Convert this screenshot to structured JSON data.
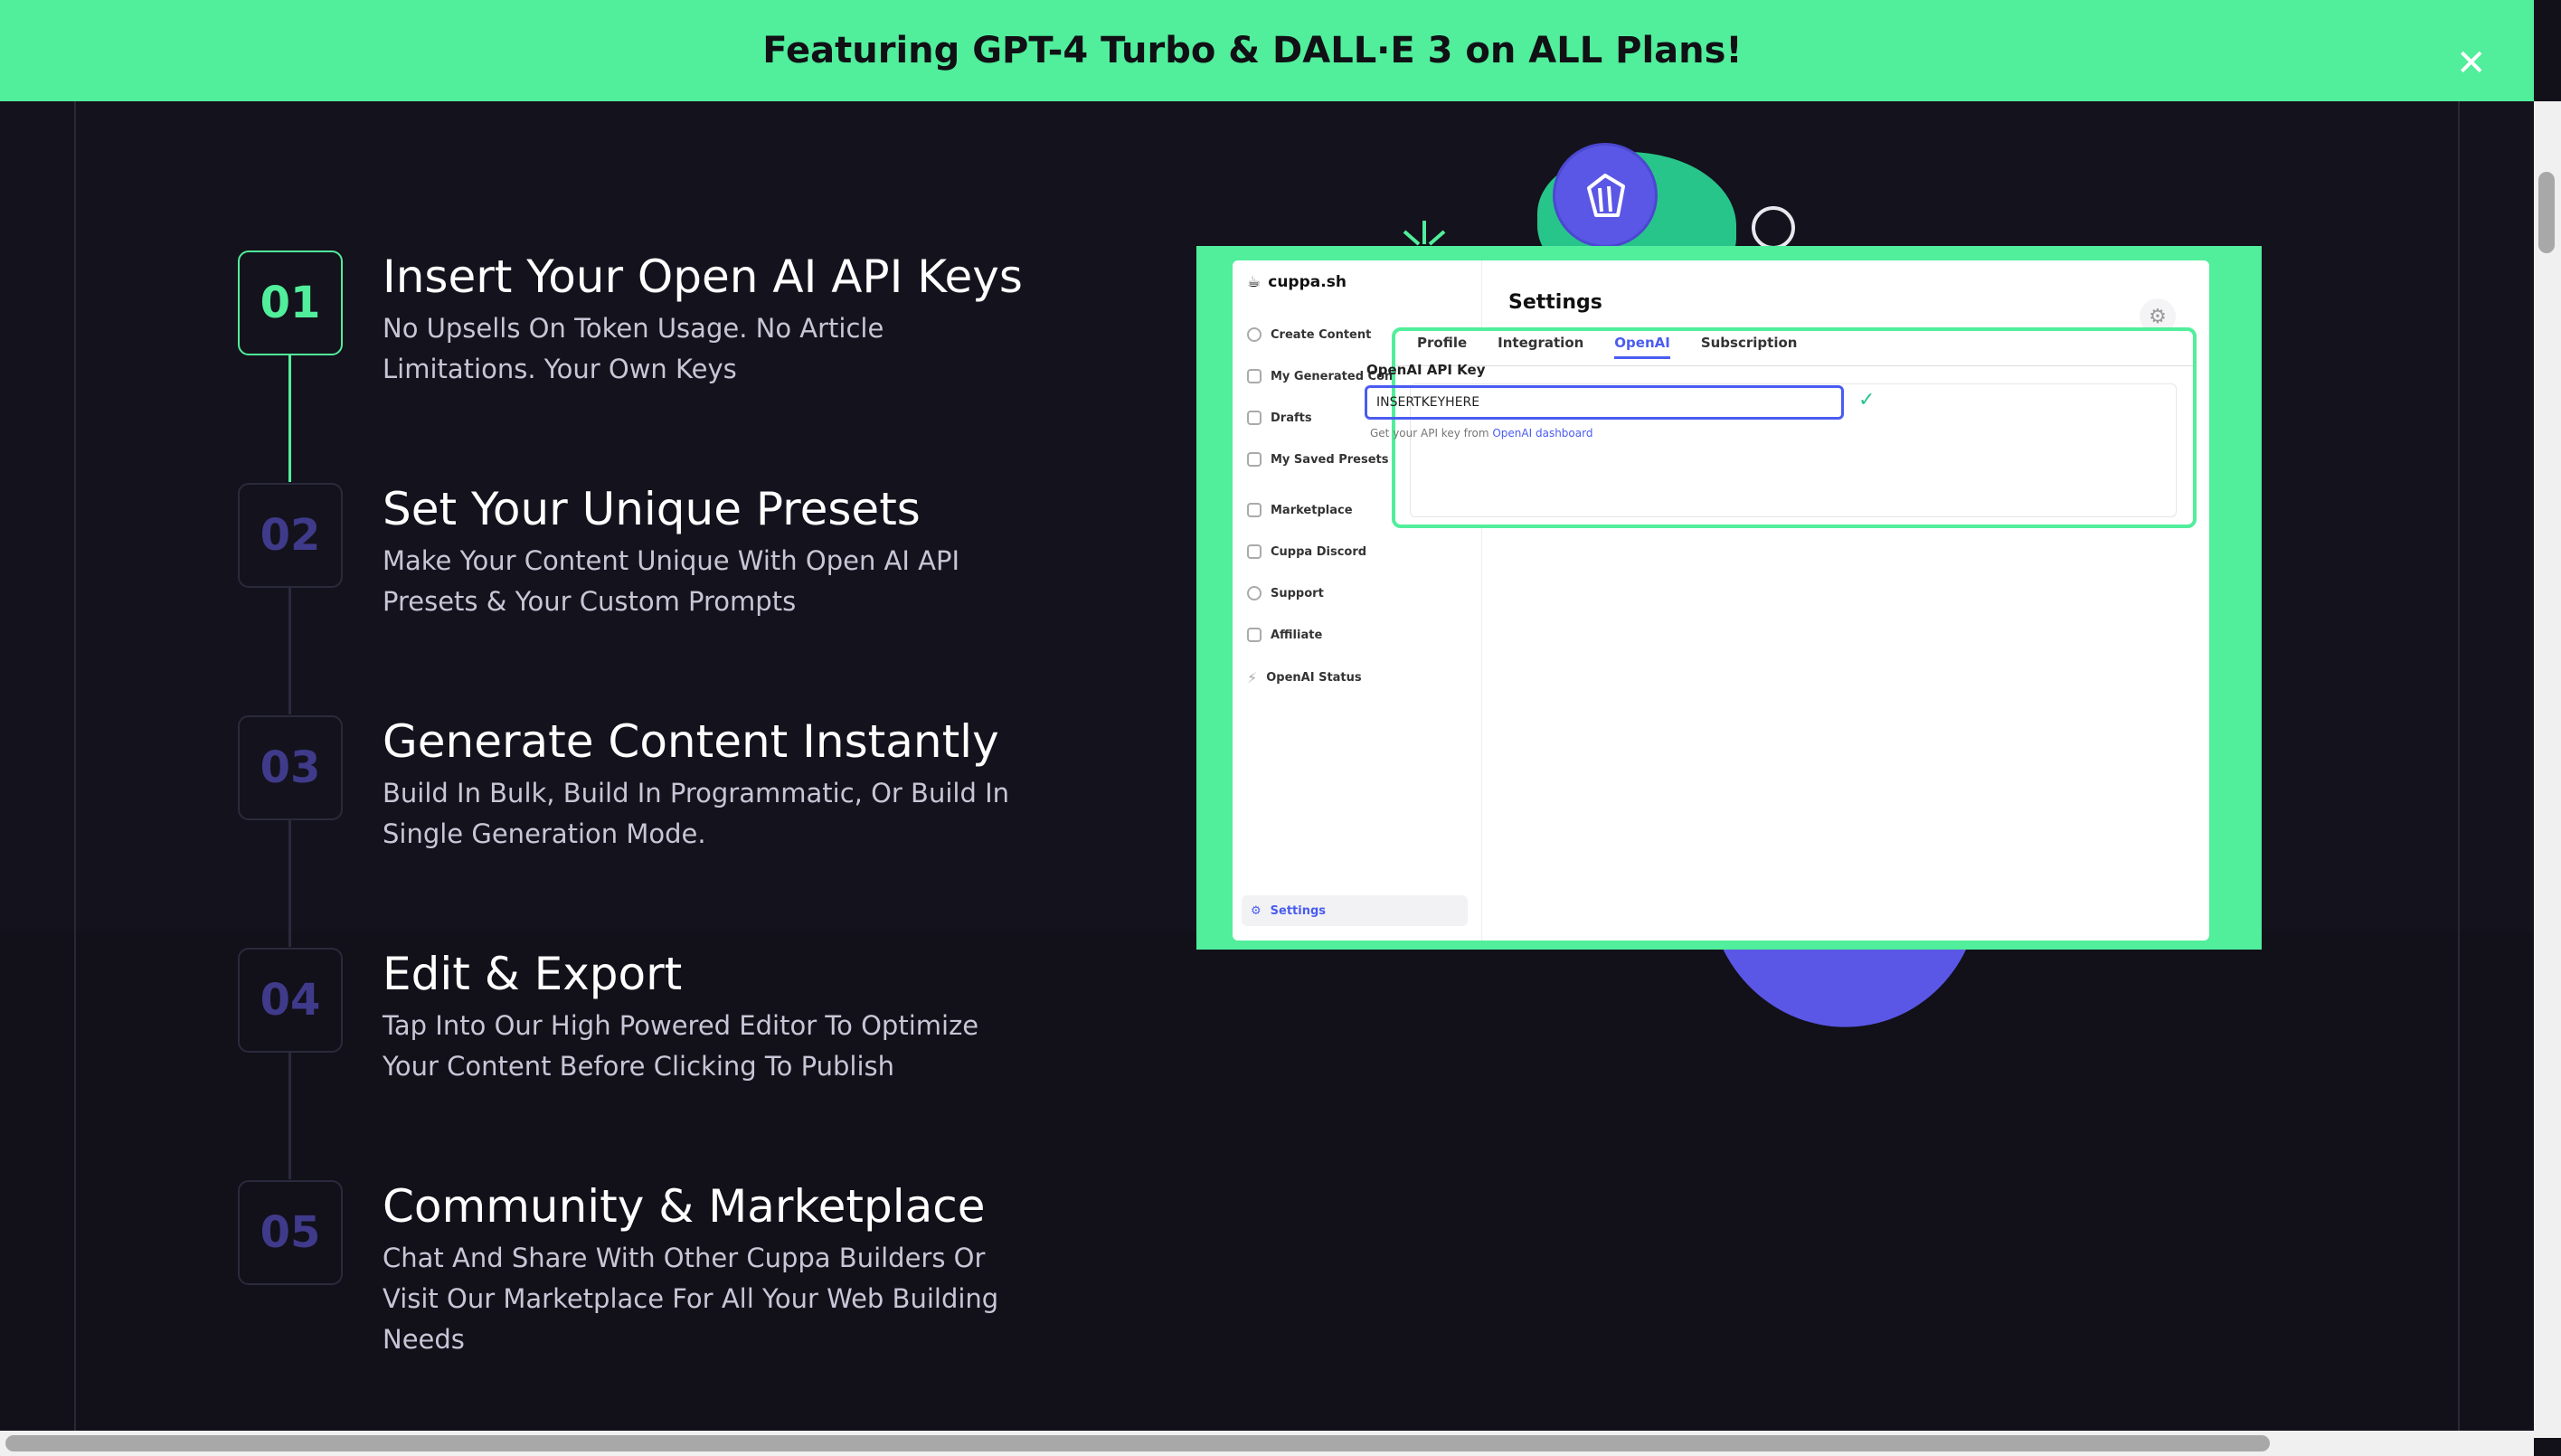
{
  "banner": {
    "text": "Featuring GPT-4 Turbo & DALL·E 3 on ALL Plans!",
    "close_glyph": "✕"
  },
  "steps": [
    {
      "num": "01",
      "title": "Insert Your Open AI API Keys",
      "desc": "No Upsells On Token Usage. No Article Limitations. Your Own Keys"
    },
    {
      "num": "02",
      "title": "Set Your Unique Presets",
      "desc": "Make Your Content Unique With Open AI API Presets & Your Custom Prompts"
    },
    {
      "num": "03",
      "title": "Generate Content Instantly",
      "desc": "Build In Bulk, Build In Programmatic, Or Build In Single Generation Mode."
    },
    {
      "num": "04",
      "title": "Edit & Export",
      "desc": "Tap Into Our High Powered Editor To Optimize Your Content Before Clicking To Publish"
    },
    {
      "num": "05",
      "title": "Community & Marketplace",
      "desc": "Chat And Share With Other Cuppa Builders Or Visit Our Marketplace For All Your Web Building Needs"
    }
  ],
  "app_preview": {
    "brand": "cuppa.sh",
    "sidebar": [
      "Create Content",
      "My Generated Con",
      "Drafts",
      "My Saved Presets",
      "Marketplace",
      "Cuppa Discord",
      "Support",
      "Affiliate",
      "OpenAI Status"
    ],
    "settings_item": "Settings",
    "title": "Settings",
    "tabs": [
      "Profile",
      "Integration",
      "OpenAI",
      "Subscription"
    ],
    "active_tab": "OpenAI",
    "key_label": "OpenAI API Key",
    "key_value": "INSERTKEYHERE",
    "help_text": "Get your API key from ",
    "help_link": "OpenAI dashboard"
  },
  "colors": {
    "accent_green": "#51ee9b",
    "accent_blue": "#5a57e6",
    "background": "#121019"
  }
}
